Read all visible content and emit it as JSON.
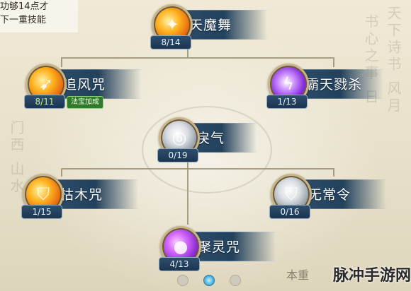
{
  "hint": {
    "line1": "功够14点才",
    "line2": "下一重技能"
  },
  "skills": {
    "tianmowu": {
      "name": "天魔舞",
      "level": "8/14",
      "orb": "orange",
      "icon": "fan-icon"
    },
    "zhuifeng": {
      "name": "追风咒",
      "level": "8/11",
      "orb": "orange",
      "icon": "runner-icon",
      "bonus": "法宝加成"
    },
    "batian": {
      "name": "霸天戮杀",
      "level": "1/13",
      "orb": "purple",
      "icon": "lightning-icon"
    },
    "liqi": {
      "name": "戾气",
      "level": "0/19",
      "orb": "silver",
      "icon": "swirl-icon"
    },
    "kumu": {
      "name": "枯木咒",
      "level": "1/15",
      "orb": "orange",
      "icon": "shield-icon"
    },
    "wuchang": {
      "name": "无常令",
      "level": "0/16",
      "orb": "silver",
      "icon": "shield-icon"
    },
    "juling": {
      "name": "聚灵咒",
      "level": "4/13",
      "orb": "magenta",
      "icon": "orb-icon"
    }
  },
  "pager": {
    "pages": 3,
    "active": 2
  },
  "footer": {
    "section_text": "本重",
    "watermark": "脉冲手游网"
  },
  "colors": {
    "banner": "#22415d",
    "orb_rim": "#c9b48a",
    "level_highlight": "#c9ee6a",
    "bonus_badge": "#2f7a2d"
  }
}
